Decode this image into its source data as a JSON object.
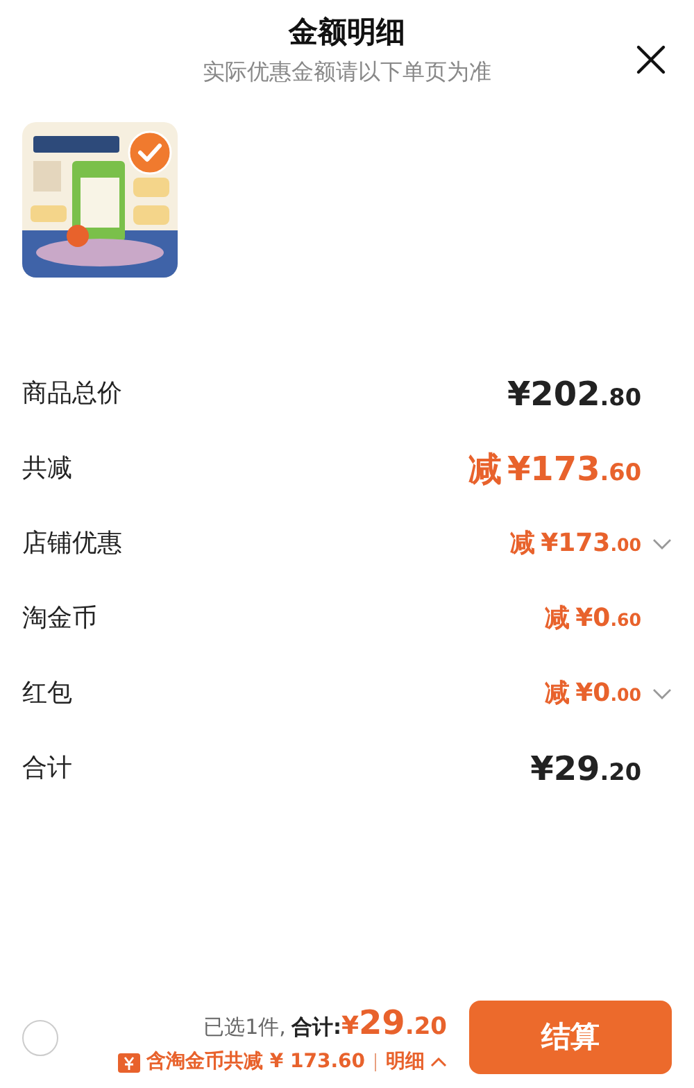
{
  "header": {
    "title": "金额明细",
    "subtitle": "实际优惠金额请以下单页为准"
  },
  "product": {
    "kind": "picture",
    "selected": true
  },
  "rows": [
    {
      "label": "商品总价",
      "kind": "total",
      "prefix": "",
      "whole": "¥202",
      "fraction": ".80",
      "expandable": false
    },
    {
      "label": "共减",
      "kind": "discount-large",
      "prefix": "减",
      "whole": "¥173",
      "fraction": ".60",
      "expandable": false
    },
    {
      "label": "店铺优惠",
      "kind": "discount",
      "prefix": "减",
      "whole": "¥173",
      "fraction": ".00",
      "expandable": true
    },
    {
      "label": "淘金币",
      "kind": "discount",
      "prefix": "减",
      "whole": "¥0",
      "fraction": ".60",
      "expandable": false
    },
    {
      "label": "红包",
      "kind": "discount",
      "prefix": "减",
      "whole": "¥0",
      "fraction": ".00",
      "expandable": true
    },
    {
      "label": "合计",
      "kind": "sum",
      "prefix": "",
      "whole": "¥29",
      "fraction": ".20",
      "expandable": false
    }
  ],
  "footer": {
    "select_all": {
      "checked": false
    },
    "selected_count": "已选1件,",
    "total_label": "合计:",
    "total_yen": "¥",
    "total_whole": "29",
    "total_fraction": ".20",
    "savings": "含淘金币共减 ¥ 173.60",
    "details": "明细",
    "details_expanded": true,
    "checkout": "结算"
  }
}
